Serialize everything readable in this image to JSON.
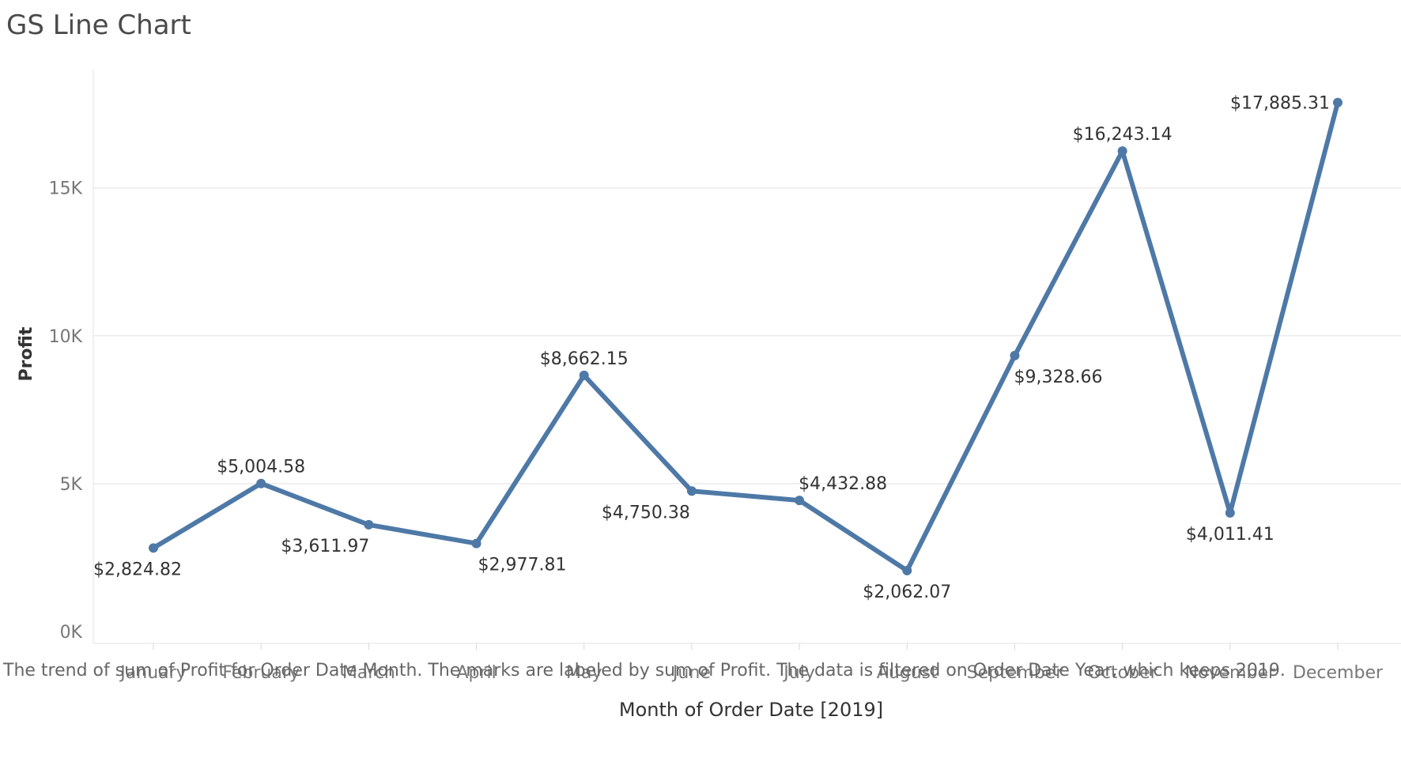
{
  "title": "GS Line Chart",
  "caption": "The trend of sum of Profit for Order Date Month.  The marks are labeled by sum of Profit. The data is filtered on Order Date Year, which keeps 2019.",
  "colors": {
    "line": "#4e79a7",
    "grid": "#ebebeb",
    "axis_text": "#777777",
    "label_text": "#333333"
  },
  "chart_data": {
    "type": "line",
    "title": "GS Line Chart",
    "xlabel": "Month of Order Date [2019]",
    "ylabel": "Profit",
    "categories": [
      "January",
      "February",
      "March",
      "April",
      "May",
      "June",
      "July",
      "August",
      "September",
      "October",
      "November",
      "December"
    ],
    "series": [
      {
        "values": [
          2824.82,
          5004.58,
          3611.97,
          2977.81,
          8662.15,
          4750.38,
          4432.88,
          2062.07,
          9328.66,
          16243.14,
          4011.41,
          17885.31
        ],
        "labels": [
          "$2,824.82",
          "$5,004.58",
          "$3,611.97",
          "$2,977.81",
          "$8,662.15",
          "$4,750.38",
          "$4,432.88",
          "$2,062.07",
          "$9,328.66",
          "$16,243.14",
          "$4,011.41",
          "$17,885.31"
        ],
        "label_positions": [
          "below",
          "above",
          "below",
          "below",
          "above",
          "below",
          "above",
          "below",
          "below",
          "above",
          "below",
          "left"
        ]
      }
    ],
    "y_ticks": [
      {
        "value": 0,
        "label": "0K"
      },
      {
        "value": 5000,
        "label": "5K"
      },
      {
        "value": 10000,
        "label": "10K"
      },
      {
        "value": 15000,
        "label": "15K"
      }
    ],
    "ylim": [
      -400,
      19000
    ],
    "grid": true,
    "legend": "none"
  }
}
